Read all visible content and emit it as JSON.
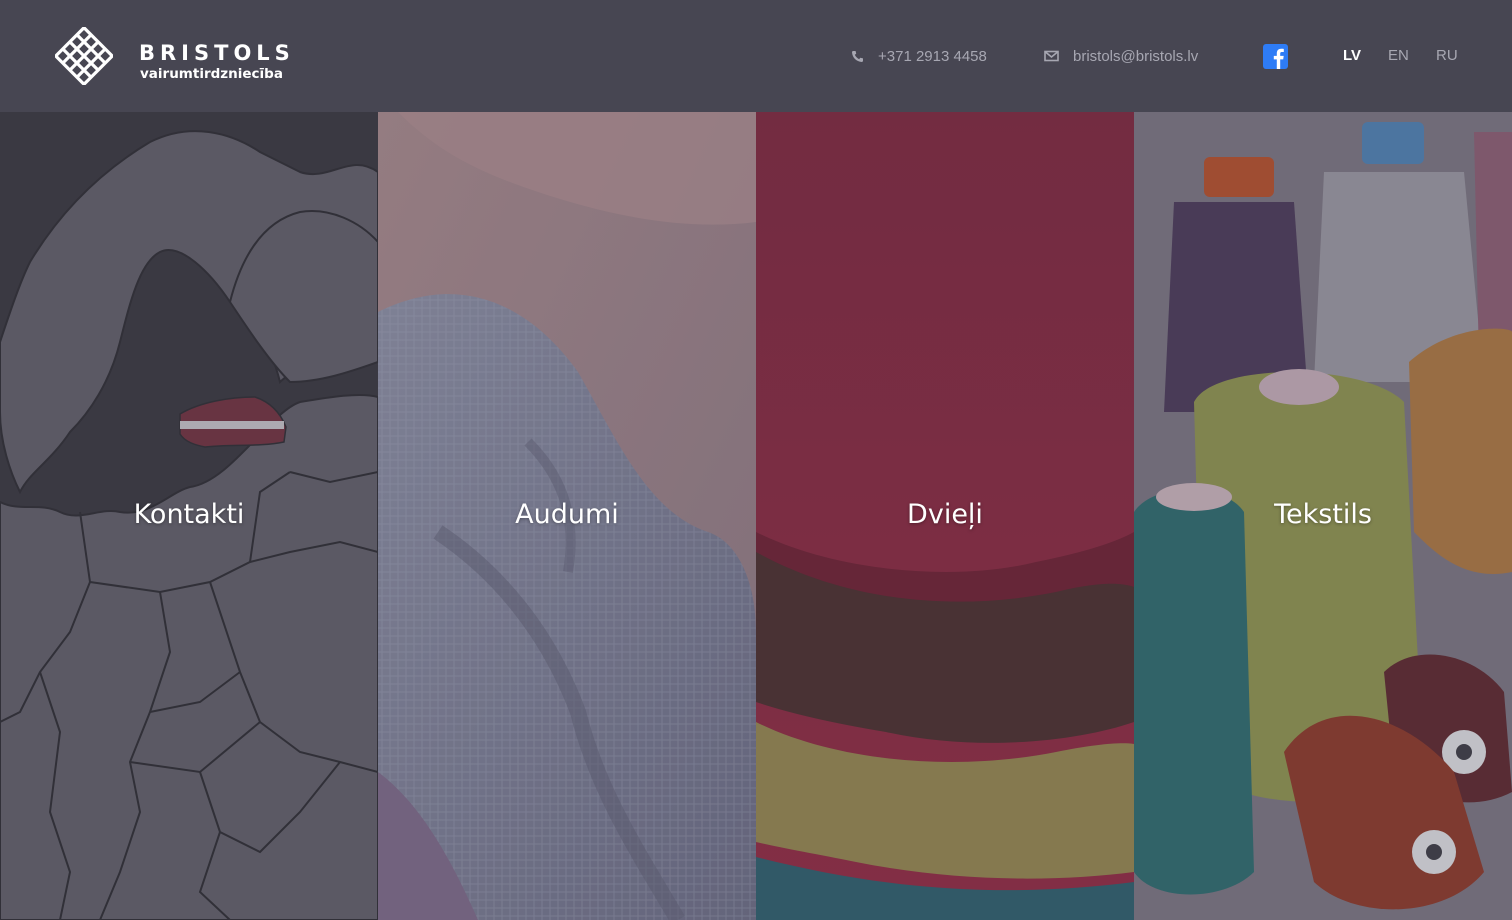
{
  "header": {
    "logo": {
      "name": "BRISTOLS",
      "tagline": "vairumtirdzniecība"
    },
    "contacts": {
      "phone": {
        "icon": "phone-icon",
        "text": "+371 2913 4458"
      },
      "email": {
        "icon": "envelope-icon",
        "text": "bristols@bristols.lv"
      }
    },
    "social": {
      "icon": "facebook-icon",
      "color": "#2e7cf6"
    },
    "languages": [
      {
        "code": "LV",
        "active": true
      },
      {
        "code": "EN",
        "active": false
      },
      {
        "code": "RU",
        "active": false
      }
    ]
  },
  "panels": [
    {
      "label": "Kontakti",
      "image": "europe-map-latvia-flag"
    },
    {
      "label": "Audumi",
      "image": "fabrics-photo"
    },
    {
      "label": "Dvieļi",
      "image": "towels-photo"
    },
    {
      "label": "Tekstils",
      "image": "thread-spools-photo"
    }
  ],
  "colors": {
    "header_bg": "#474652",
    "header_text": "#a7a7b2",
    "active_lang": "#ffffff",
    "overlay": "#3f3e47"
  }
}
